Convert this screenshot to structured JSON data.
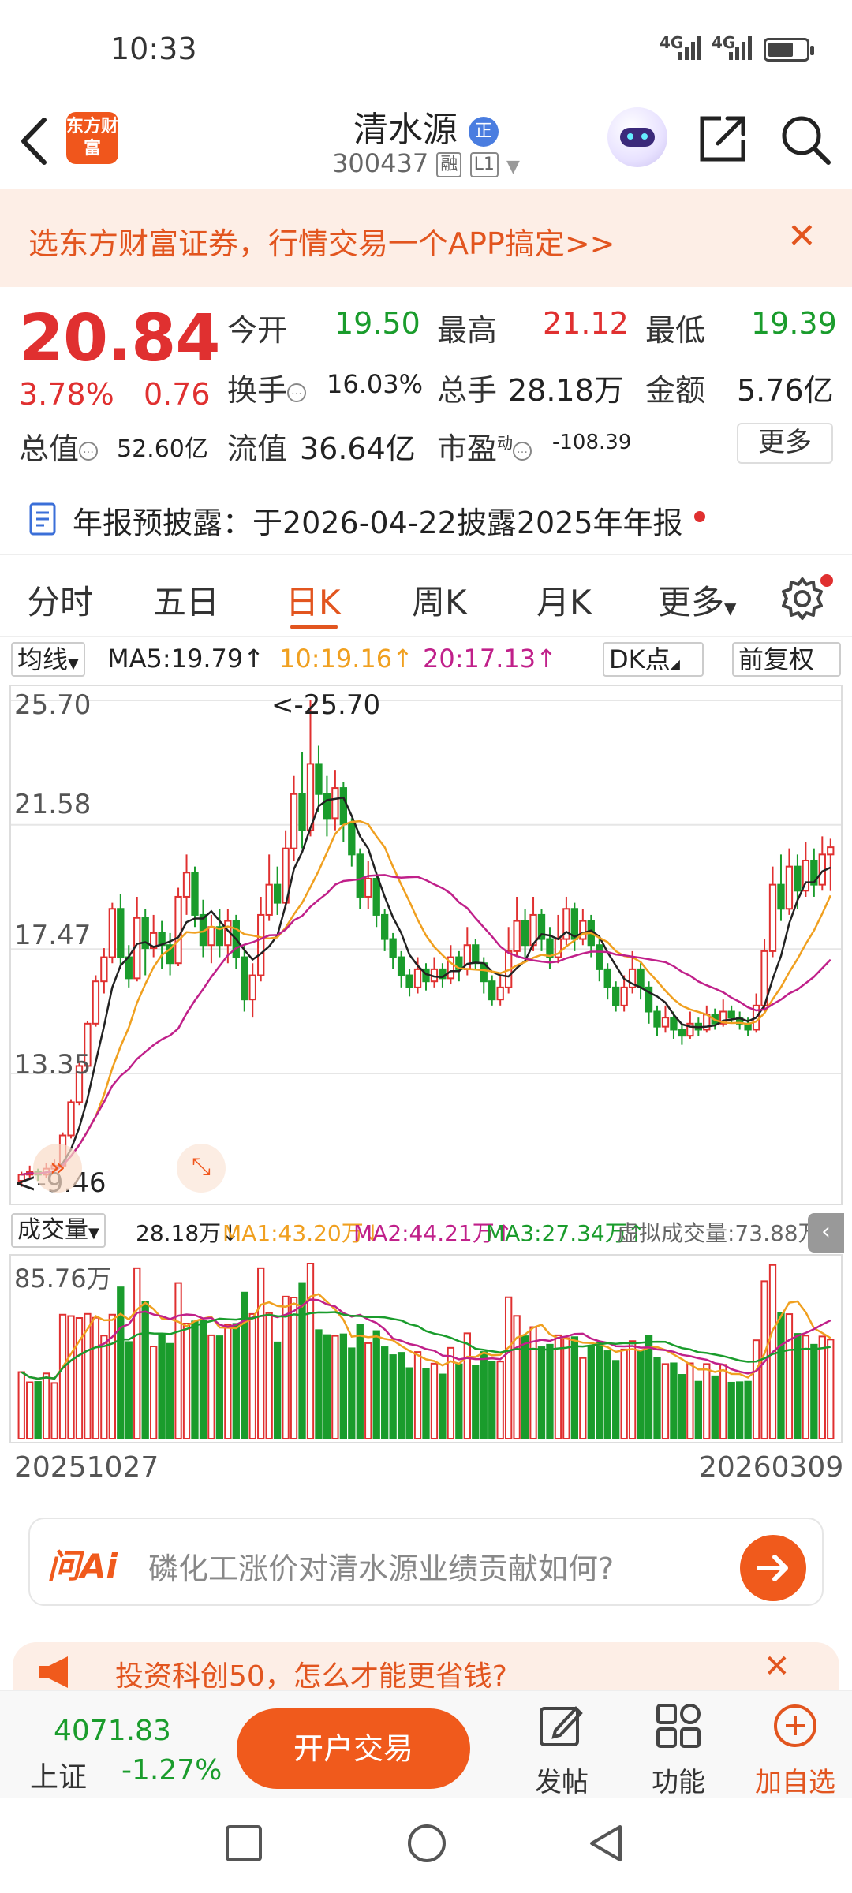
{
  "status_bar": {
    "time": "10:33",
    "signal1": "4G",
    "signal2": "4G"
  },
  "header": {
    "stock_name": "清水源",
    "badge": "正",
    "stock_code": "300437",
    "tag_margin": "融",
    "tag_level": "L1",
    "logo_text": "东方财富"
  },
  "promo_banner": {
    "text": "选东方财富证券，行情交易一个APP搞定>>"
  },
  "quote": {
    "price": "20.84",
    "change_pct": "3.78%",
    "change": "0.76",
    "open_label": "今开",
    "open_value": "19.50",
    "high_label": "最高",
    "high_value": "21.12",
    "low_label": "最低",
    "low_value": "19.39",
    "turnover_label": "换手",
    "turnover_value": "16.03%",
    "volume_label": "总手",
    "volume_value": "28.18万",
    "amount_label": "金额",
    "amount_value": "5.76亿",
    "mktcap_label": "总值",
    "mktcap_value": "52.60亿",
    "float_label": "流值",
    "float_value": "36.64亿",
    "pe_label": "市盈",
    "pe_sup": "动",
    "pe_value": "-108.39",
    "more_label": "更多"
  },
  "notice": {
    "text": "年报预披露：于2026-04-22披露2025年年报"
  },
  "tabs": [
    "分时",
    "五日",
    "日K",
    "周K",
    "月K",
    "更多"
  ],
  "active_tab": 2,
  "ma_bar": {
    "selector": "均线",
    "ma5": "MA5:19.79↑",
    "ma10": "10:19.16↑",
    "ma20": "20:17.13↑",
    "dk": "DK点",
    "adjust": "前复权"
  },
  "chart_axis": {
    "y_labels": [
      "25.70",
      "21.58",
      "17.47",
      "13.35"
    ],
    "max_marker": "<-25.70",
    "min_marker": "<-9.46"
  },
  "volume_bar": {
    "selector": "成交量",
    "vol": "28.18万↓",
    "ma1": "MA1:43.20万↓",
    "ma2": "MA2:44.21万↑",
    "ma3": "MA3:27.34万↑",
    "virtual": "虚拟成交量:73.88万",
    "max_label": "85.76万"
  },
  "dates": {
    "start": "20251027",
    "end": "20260309"
  },
  "ai": {
    "logo": "问Ai",
    "question": "磷化工涨价对清水源业绩贡献如何?"
  },
  "promo2": {
    "text": "投资科创50，怎么才能更省钱?"
  },
  "bottom": {
    "index_value": "4071.83",
    "index_name": "上证",
    "index_pct": "-1.27%",
    "trade_button": "开户交易",
    "post": "发帖",
    "func": "功能",
    "add": "加自选"
  },
  "colors": {
    "up": "#e03030",
    "down": "#1a9c2c",
    "accent": "#f05a1c",
    "ma5": "#222222",
    "ma10": "#f0a020",
    "ma20": "#c0208a"
  },
  "chart_data": {
    "type": "candlestick",
    "ylim": [
      9.46,
      25.7
    ],
    "y_ticks": [
      25.7,
      21.58,
      17.47,
      13.35
    ],
    "candles": [
      [
        9.8,
        10.0,
        10.1,
        9.6
      ],
      [
        10.0,
        10.1,
        10.3,
        9.9
      ],
      [
        10.1,
        10.0,
        10.2,
        9.8
      ],
      [
        10.0,
        10.2,
        10.4,
        9.9
      ],
      [
        10.2,
        10.3,
        10.5,
        10.1
      ],
      [
        10.3,
        11.3,
        11.4,
        10.2
      ],
      [
        11.3,
        12.4,
        12.5,
        11.2
      ],
      [
        12.4,
        13.6,
        13.7,
        12.3
      ],
      [
        13.6,
        15.0,
        15.1,
        13.5
      ],
      [
        15.0,
        16.4,
        16.6,
        14.9
      ],
      [
        16.4,
        17.2,
        17.5,
        16.0
      ],
      [
        17.2,
        18.8,
        19.0,
        17.0
      ],
      [
        18.8,
        17.2,
        19.3,
        16.8
      ],
      [
        17.2,
        16.5,
        17.6,
        16.2
      ],
      [
        16.5,
        18.5,
        19.2,
        16.4
      ],
      [
        18.5,
        17.5,
        18.8,
        16.6
      ],
      [
        17.5,
        18.0,
        18.6,
        17.2
      ],
      [
        18.0,
        17.6,
        18.4,
        16.8
      ],
      [
        17.6,
        17.0,
        18.0,
        16.6
      ],
      [
        17.0,
        19.2,
        19.5,
        16.9
      ],
      [
        19.2,
        20.0,
        20.6,
        18.6
      ],
      [
        20.0,
        18.6,
        20.2,
        18.2
      ],
      [
        18.6,
        17.6,
        19.1,
        17.2
      ],
      [
        17.6,
        18.2,
        18.6,
        17.0
      ],
      [
        18.2,
        17.6,
        18.8,
        17.2
      ],
      [
        17.6,
        18.4,
        18.8,
        17.0
      ],
      [
        18.4,
        17.2,
        18.6,
        16.8
      ],
      [
        17.2,
        15.8,
        17.6,
        15.4
      ],
      [
        15.8,
        16.6,
        17.0,
        15.2
      ],
      [
        16.6,
        18.6,
        19.2,
        16.4
      ],
      [
        18.6,
        19.6,
        20.6,
        18.4
      ],
      [
        19.6,
        19.0,
        20.2,
        18.6
      ],
      [
        19.0,
        20.8,
        21.4,
        18.8
      ],
      [
        20.8,
        22.6,
        23.2,
        20.4
      ],
      [
        22.6,
        21.4,
        24.0,
        20.8
      ],
      [
        21.4,
        23.6,
        25.7,
        21.2
      ],
      [
        23.6,
        22.6,
        24.2,
        22.0
      ],
      [
        22.6,
        21.8,
        23.2,
        21.2
      ],
      [
        21.8,
        22.8,
        23.4,
        21.4
      ],
      [
        22.8,
        21.6,
        23.0,
        21.0
      ],
      [
        21.6,
        20.6,
        21.8,
        20.2
      ],
      [
        20.6,
        19.2,
        20.8,
        18.8
      ],
      [
        19.2,
        19.8,
        20.4,
        18.8
      ],
      [
        19.8,
        18.6,
        20.0,
        18.2
      ],
      [
        18.6,
        17.8,
        18.8,
        17.4
      ],
      [
        17.8,
        17.2,
        18.0,
        16.8
      ],
      [
        17.2,
        16.6,
        17.4,
        16.2
      ],
      [
        16.6,
        16.2,
        16.8,
        15.9
      ],
      [
        16.2,
        16.8,
        17.2,
        16.0
      ],
      [
        16.8,
        16.4,
        17.0,
        16.1
      ],
      [
        16.4,
        16.8,
        17.2,
        16.2
      ],
      [
        16.8,
        16.5,
        17.0,
        16.2
      ],
      [
        16.5,
        17.2,
        17.6,
        16.3
      ],
      [
        17.2,
        16.8,
        17.4,
        16.4
      ],
      [
        16.8,
        17.6,
        18.2,
        16.6
      ],
      [
        17.6,
        17.0,
        17.8,
        16.8
      ],
      [
        17.0,
        16.4,
        17.2,
        16.0
      ],
      [
        16.4,
        15.8,
        16.6,
        15.6
      ],
      [
        15.8,
        16.2,
        16.6,
        15.6
      ],
      [
        16.2,
        17.4,
        18.2,
        16.0
      ],
      [
        17.4,
        18.4,
        19.2,
        17.2
      ],
      [
        18.4,
        17.6,
        18.8,
        17.2
      ],
      [
        17.6,
        18.6,
        19.2,
        17.4
      ],
      [
        18.6,
        17.8,
        18.8,
        17.4
      ],
      [
        17.8,
        17.2,
        18.2,
        16.8
      ],
      [
        17.2,
        17.8,
        18.6,
        17.0
      ],
      [
        17.8,
        18.8,
        19.2,
        17.6
      ],
      [
        18.8,
        17.8,
        19.0,
        17.4
      ],
      [
        17.8,
        18.4,
        18.8,
        17.6
      ],
      [
        18.4,
        17.6,
        18.6,
        17.2
      ],
      [
        17.6,
        16.8,
        17.8,
        16.4
      ],
      [
        16.8,
        16.2,
        17.0,
        15.8
      ],
      [
        16.2,
        15.6,
        16.4,
        15.4
      ],
      [
        15.6,
        16.2,
        16.6,
        15.4
      ],
      [
        16.2,
        16.8,
        17.4,
        16.0
      ],
      [
        16.8,
        16.2,
        17.0,
        15.8
      ],
      [
        16.2,
        15.4,
        16.4,
        15.0
      ],
      [
        15.4,
        14.9,
        15.6,
        14.6
      ],
      [
        14.9,
        15.2,
        15.6,
        14.7
      ],
      [
        15.2,
        14.8,
        15.4,
        14.5
      ],
      [
        14.8,
        14.6,
        15.0,
        14.3
      ],
      [
        14.6,
        15.0,
        15.4,
        14.5
      ],
      [
        15.0,
        14.8,
        15.2,
        14.6
      ],
      [
        14.8,
        15.3,
        15.6,
        14.7
      ],
      [
        15.3,
        15.0,
        15.5,
        14.8
      ],
      [
        15.0,
        15.4,
        15.8,
        14.9
      ],
      [
        15.4,
        15.2,
        15.6,
        15.0
      ],
      [
        15.2,
        15.0,
        15.4,
        14.8
      ],
      [
        15.0,
        14.8,
        15.2,
        14.6
      ],
      [
        14.8,
        15.6,
        16.0,
        14.7
      ],
      [
        15.6,
        17.4,
        17.8,
        15.4
      ],
      [
        17.4,
        19.6,
        20.2,
        17.2
      ],
      [
        19.6,
        18.8,
        20.6,
        18.4
      ],
      [
        18.8,
        20.2,
        20.8,
        18.6
      ],
      [
        20.2,
        19.4,
        20.6,
        18.8
      ],
      [
        19.4,
        20.4,
        21.0,
        19.2
      ],
      [
        20.4,
        19.6,
        20.8,
        19.2
      ],
      [
        19.6,
        20.6,
        21.2,
        19.4
      ],
      [
        20.6,
        20.84,
        21.12,
        19.39
      ]
    ],
    "volume_max": 85.76,
    "volume_unit": "万"
  }
}
